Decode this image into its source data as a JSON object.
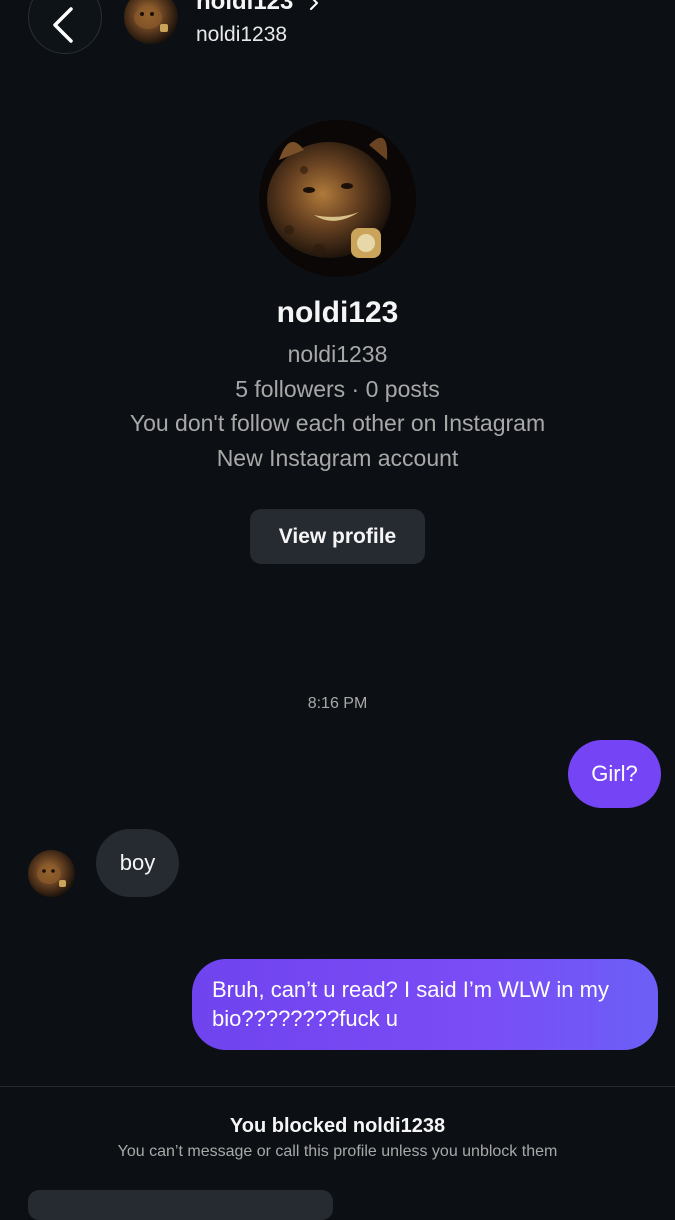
{
  "header": {
    "name": "noldi123",
    "handle": "noldi1238",
    "back_icon": "chevron-left-icon",
    "chevron_icon": "chevron-right-icon"
  },
  "profile": {
    "name": "noldi123",
    "handle": "noldi1238",
    "stats": "5 followers · 0 posts",
    "follow_status": "You don't follow each other on Instagram",
    "account_note": "New Instagram account",
    "view_profile_label": "View profile"
  },
  "conversation": {
    "timestamp": "8:16 PM",
    "messages": [
      {
        "direction": "outgoing",
        "text": "Girl?"
      },
      {
        "direction": "incoming",
        "text": "boy"
      },
      {
        "direction": "outgoing",
        "text": "Bruh, can’t u read? I said I’m WLW in my bio????????fuck u"
      }
    ]
  },
  "blocked": {
    "title": "You blocked noldi1238",
    "subtitle": "You can’t message or call this profile unless you unblock them"
  },
  "colors": {
    "background": "#0c1014",
    "outgoing_bubble": "#7545f5",
    "incoming_bubble": "#262a31",
    "secondary_text": "#a8a8a8"
  }
}
